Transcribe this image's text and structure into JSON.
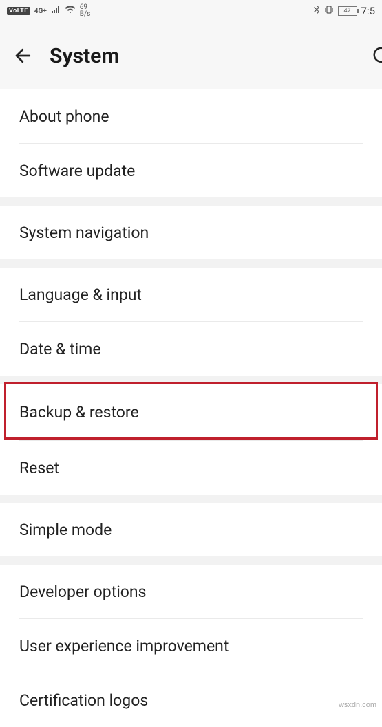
{
  "statusbar": {
    "volte": "VoLTE",
    "net_label": "4G+",
    "speed_top": "69",
    "speed_bottom": "B/s",
    "battery": "47",
    "time": "7:5"
  },
  "header": {
    "title": "System"
  },
  "groups": [
    {
      "items": [
        "About phone",
        "Software update"
      ]
    },
    {
      "items": [
        "System navigation"
      ]
    },
    {
      "items": [
        "Language & input",
        "Date & time"
      ]
    },
    {
      "items": [
        "Backup & restore",
        "Reset"
      ]
    },
    {
      "items": [
        "Simple mode"
      ]
    },
    {
      "items": [
        "Developer options",
        "User experience improvement",
        "Certification logos"
      ]
    }
  ],
  "watermark": "wsxdn.com"
}
